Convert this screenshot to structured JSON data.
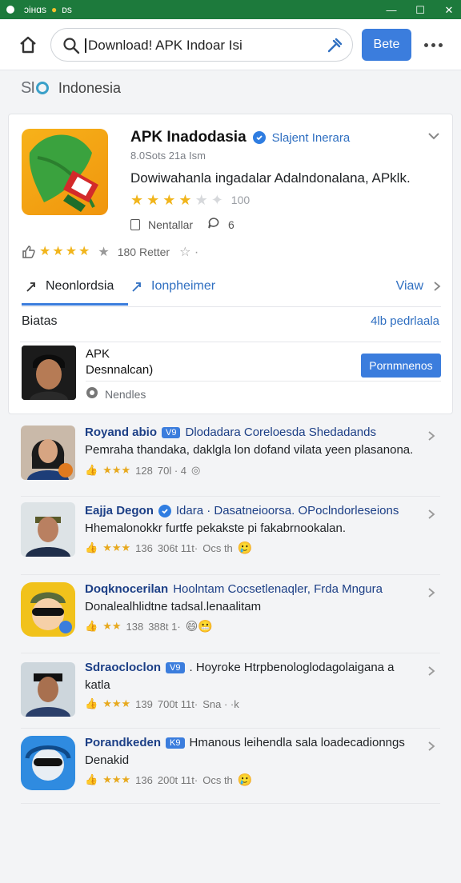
{
  "status_bar": {
    "left_text": "ɔiнɑs",
    "secondary": "ᴅs"
  },
  "toolbar": {
    "search_value": "Download! APK Indoar Isi",
    "go_label": "Bete"
  },
  "region": {
    "logo_text": "SI",
    "label": "Indonesia"
  },
  "app": {
    "title": "APK Inadodasia",
    "developer": "Slajent Inerara",
    "subtitle": "8.0Sots 21a Ism",
    "description": "Dowiwahanla ingadalar Adalndonalana, APklk.",
    "rating_count": "100",
    "meta_installs": "Nentallar",
    "meta_reviews": "6",
    "votes_text": "180 Retter",
    "tab_active": "Neonlordsia",
    "tab_alt": "Ionpheimer",
    "view_label": "Viaw",
    "section_title": "Biatas",
    "section_link": "4lb pedrlaala",
    "item_title": "APK",
    "item_sub": "Desnnalcan)",
    "item_meta": "Nendles",
    "item_button": "Pornmnenos"
  },
  "list": [
    {
      "name": "Royand abio",
      "badge": "V9",
      "title_text": "Dlodadara Coreloesda Shedadands",
      "desc": "Pemraha thandaka, daklgla lon dofand vilata yeen plasanona.",
      "rating": "128",
      "downloads": "70l · 4",
      "extra": ""
    },
    {
      "name": "Eajja Degon",
      "badge": "",
      "title_text": "Idara · Dasatneioorsa. OPoclndorleseions",
      "desc": "Hhemalonokkr furtfe pekakste pi fakabrnookalan.",
      "rating": "136",
      "downloads": "306t 11t·",
      "extra": "Ocs th"
    },
    {
      "name": "Doqknocerilan",
      "badge": "",
      "title_text": "Hoolntam Cocsetlenaqler, Frda Mngura",
      "desc": "Donalealhlidtne tadsal.lenaalitam",
      "rating": "138",
      "downloads": "388t 1·",
      "extra": ""
    },
    {
      "name": "Sdraocloclon",
      "badge": "V9",
      "title_text": ". Hoyroke Htrpbenologlodagolaigana   a",
      "desc": "katla",
      "rating": "139",
      "downloads": "700t 11t·",
      "extra": "Sna · ·k"
    },
    {
      "name": "Porandkeden",
      "badge": "K9",
      "title_text": "Hmanous leihendla sala loadecadionngs",
      "desc": "Denakid",
      "rating": "136",
      "downloads": "200t 11t·",
      "extra": "Ocs th"
    }
  ],
  "colors": {
    "brand_green": "#1d7a3c",
    "accent_blue": "#3b7ddd",
    "star": "#f1b51c"
  }
}
